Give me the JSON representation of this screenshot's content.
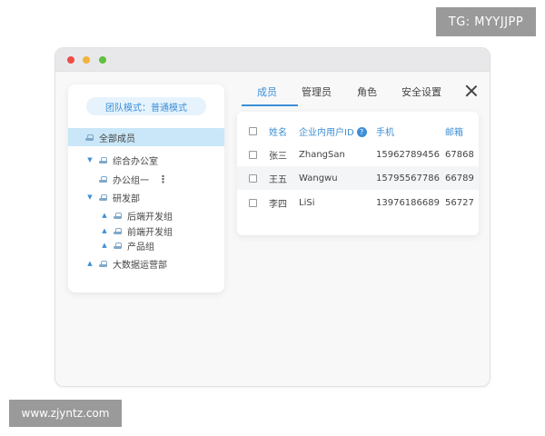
{
  "watermarks": {
    "top": "TG: MYYJJPP",
    "bottom": "www.zjyntz.com"
  },
  "sidebar": {
    "mode_label": "团队模式：普通模式",
    "items": [
      {
        "label": "全部成员",
        "selected": true
      },
      {
        "label": "综合办公室"
      },
      {
        "label": "办公组一"
      },
      {
        "label": "研发部"
      },
      {
        "label": "后端开发组"
      },
      {
        "label": "前端开发组"
      },
      {
        "label": "产品组"
      },
      {
        "label": "大数据运营部"
      }
    ],
    "more_icon": "⋮"
  },
  "tabs": [
    {
      "label": "成员",
      "active": true
    },
    {
      "label": "管理员"
    },
    {
      "label": "角色"
    },
    {
      "label": "安全设置"
    }
  ],
  "table": {
    "columns": [
      "姓名",
      "企业内用户ID",
      "手机",
      "邮箱"
    ],
    "rows": [
      {
        "name": "张三",
        "id": "ZhangSan",
        "phone": "15962789456",
        "email": "67868"
      },
      {
        "name": "王五",
        "id": "Wangwu",
        "phone": "15795567786",
        "email": "66789"
      },
      {
        "name": "李四",
        "id": "LiSi",
        "phone": "13976186689",
        "email": "56727"
      }
    ],
    "help_icon": "?"
  },
  "colors": {
    "accent": "#3d8fd6",
    "selected_bg": "#c9e7f8",
    "window_bg": "#f8f8f9"
  }
}
